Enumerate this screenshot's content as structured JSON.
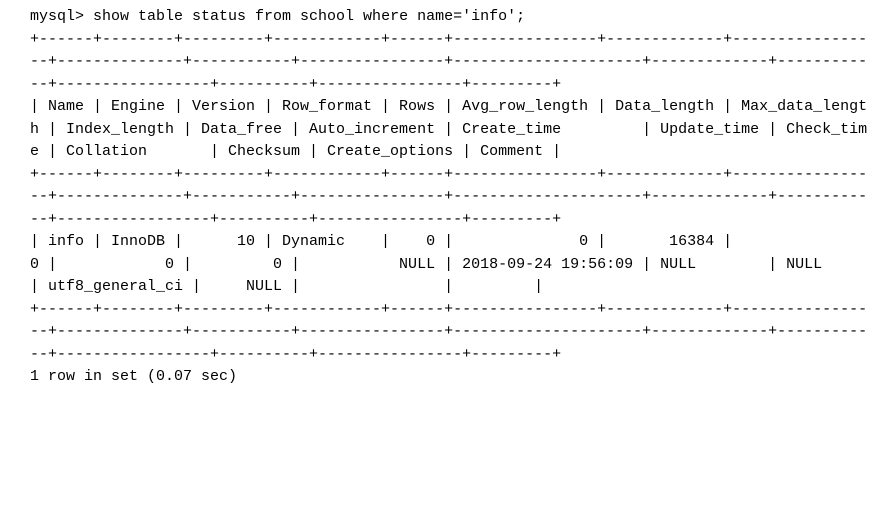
{
  "prompt": "mysql> ",
  "command": "show table status from school where name='info';",
  "sep_line": "+------+--------+---------+------------+------+----------------+-------------+-----------------+--------------+-----------+----------------+---------------------+-------------+------------+-----------------+----------+----------------+---------+",
  "header_line": "| Name | Engine | Version | Row_format | Rows | Avg_row_length | Data_length | Max_data_length | Index_length | Data_free | Auto_increment | Create_time         | Update_time | Check_time | Collation       | Checksum | Create_options | Comment |",
  "data_line": "| info | InnoDB |      10 | Dynamic    |    0 |              0 |       16384 |               0 |            0 |         0 |           NULL | 2018-09-24 19:56:09 | NULL        | NULL       | utf8_general_ci |     NULL |                |         |",
  "footer": "1 row in set (0.07 sec)",
  "chart_data": {
    "type": "table",
    "query": "show table status from school where name='info';",
    "headers": [
      "Name",
      "Engine",
      "Version",
      "Row_format",
      "Rows",
      "Avg_row_length",
      "Data_length",
      "Max_data_length",
      "Index_length",
      "Data_free",
      "Auto_increment",
      "Create_time",
      "Update_time",
      "Check_time",
      "Collation",
      "Checksum",
      "Create_options",
      "Comment"
    ],
    "rows": [
      {
        "Name": "info",
        "Engine": "InnoDB",
        "Version": 10,
        "Row_format": "Dynamic",
        "Rows": 0,
        "Avg_row_length": 0,
        "Data_length": 16384,
        "Max_data_length": 0,
        "Index_length": 0,
        "Data_free": 0,
        "Auto_increment": "NULL",
        "Create_time": "2018-09-24 19:56:09",
        "Update_time": "NULL",
        "Check_time": "NULL",
        "Collation": "utf8_general_ci",
        "Checksum": "NULL",
        "Create_options": "",
        "Comment": ""
      }
    ],
    "rows_in_set": 1,
    "elapsed_sec": 0.07
  }
}
